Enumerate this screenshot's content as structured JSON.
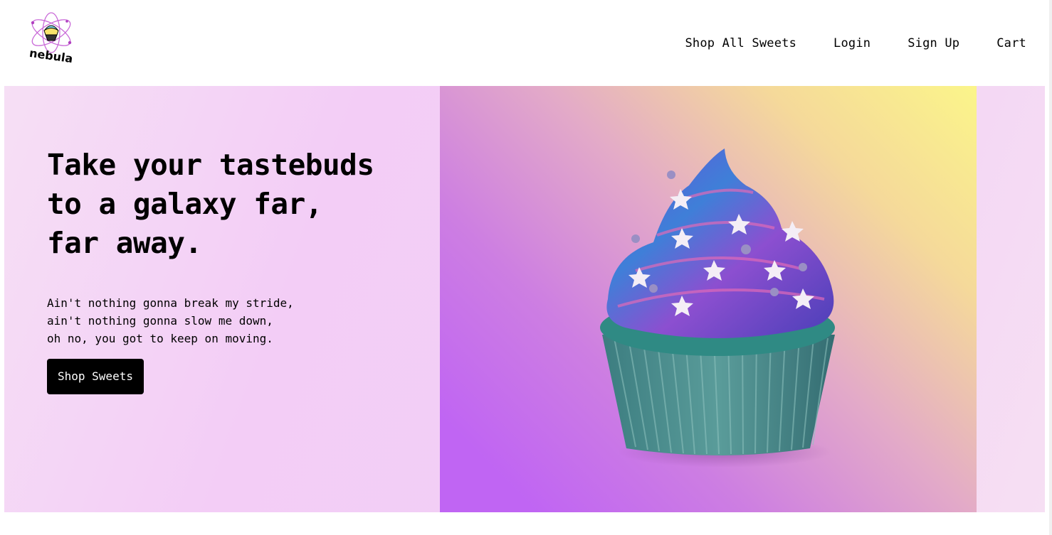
{
  "brand": {
    "name": "nebula",
    "logo_icon": "nebula-cupcake-atom-logo"
  },
  "nav": {
    "items": [
      {
        "label": "Shop All Sweets"
      },
      {
        "label": "Login"
      },
      {
        "label": "Sign Up"
      },
      {
        "label": "Cart"
      }
    ]
  },
  "hero": {
    "headline_lines": [
      "Take your tastebuds",
      "to a galaxy far,",
      "far away."
    ],
    "lyrics": [
      "Ain't nothing gonna break my stride,",
      "ain't nothing gonna slow me down,",
      "oh no, you got to keep on moving."
    ],
    "cta_label": "Shop Sweets",
    "image_icon": "galaxy-cupcake-image"
  },
  "colors": {
    "accent": "#000000",
    "hero_bg": "#f3cdf6",
    "gradient_start": "#c065f3",
    "gradient_end": "#fbf58a"
  }
}
